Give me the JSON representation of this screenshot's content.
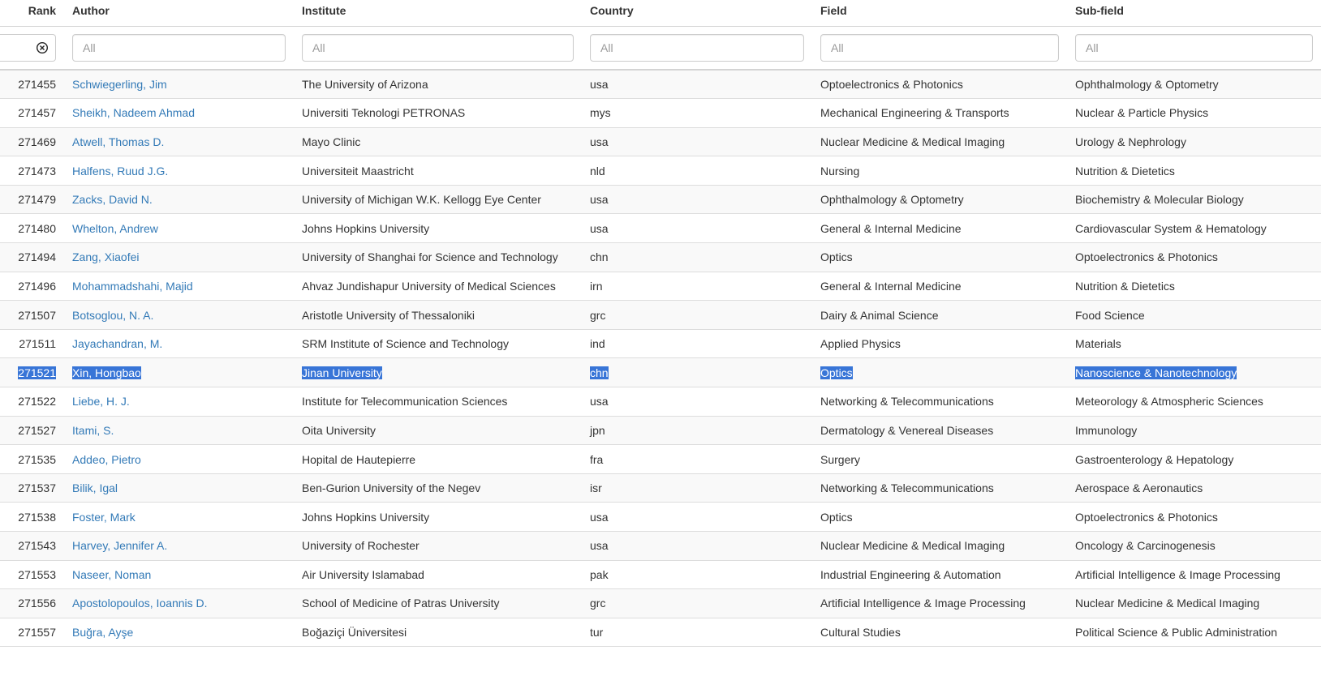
{
  "columns": {
    "rank": "Rank",
    "author": "Author",
    "institute": "Institute",
    "country": "Country",
    "field": "Field",
    "subfield": "Sub-field"
  },
  "filters": {
    "placeholder": "All"
  },
  "rows": [
    {
      "rank": "271455",
      "author": "Schwiegerling, Jim",
      "institute": "The University of Arizona",
      "country": "usa",
      "field": "Optoelectronics & Photonics",
      "subfield": "Ophthalmology & Optometry"
    },
    {
      "rank": "271457",
      "author": "Sheikh, Nadeem Ahmad",
      "institute": "Universiti Teknologi PETRONAS",
      "country": "mys",
      "field": "Mechanical Engineering & Transports",
      "subfield": "Nuclear & Particle Physics"
    },
    {
      "rank": "271469",
      "author": "Atwell, Thomas D.",
      "institute": "Mayo Clinic",
      "country": "usa",
      "field": "Nuclear Medicine & Medical Imaging",
      "subfield": "Urology & Nephrology"
    },
    {
      "rank": "271473",
      "author": "Halfens, Ruud J.G.",
      "institute": "Universiteit Maastricht",
      "country": "nld",
      "field": "Nursing",
      "subfield": "Nutrition & Dietetics"
    },
    {
      "rank": "271479",
      "author": "Zacks, David N.",
      "institute": "University of Michigan W.K. Kellogg Eye Center",
      "country": "usa",
      "field": "Ophthalmology & Optometry",
      "subfield": "Biochemistry & Molecular Biology"
    },
    {
      "rank": "271480",
      "author": "Whelton, Andrew",
      "institute": "Johns Hopkins University",
      "country": "usa",
      "field": "General & Internal Medicine",
      "subfield": "Cardiovascular System & Hematology"
    },
    {
      "rank": "271494",
      "author": "Zang, Xiaofei",
      "institute": "University of Shanghai for Science and Technology",
      "country": "chn",
      "field": "Optics",
      "subfield": "Optoelectronics & Photonics"
    },
    {
      "rank": "271496",
      "author": "Mohammadshahi, Majid",
      "institute": "Ahvaz Jundishapur University of Medical Sciences",
      "country": "irn",
      "field": "General & Internal Medicine",
      "subfield": "Nutrition & Dietetics"
    },
    {
      "rank": "271507",
      "author": "Botsoglou, N. A.",
      "institute": "Aristotle University of Thessaloniki",
      "country": "grc",
      "field": "Dairy & Animal Science",
      "subfield": "Food Science"
    },
    {
      "rank": "271511",
      "author": "Jayachandran, M.",
      "institute": "SRM Institute of Science and Technology",
      "country": "ind",
      "field": "Applied Physics",
      "subfield": "Materials"
    },
    {
      "rank": "271521",
      "author": "Xin, Hongbao",
      "institute": "Jinan University",
      "country": "chn",
      "field": "Optics",
      "subfield": "Nanoscience & Nanotechnology"
    },
    {
      "rank": "271522",
      "author": "Liebe, H. J.",
      "institute": "Institute for Telecommunication Sciences",
      "country": "usa",
      "field": "Networking & Telecommunications",
      "subfield": "Meteorology & Atmospheric Sciences"
    },
    {
      "rank": "271527",
      "author": "Itami, S.",
      "institute": "Oita University",
      "country": "jpn",
      "field": "Dermatology & Venereal Diseases",
      "subfield": "Immunology"
    },
    {
      "rank": "271535",
      "author": "Addeo, Pietro",
      "institute": "Hopital de Hautepierre",
      "country": "fra",
      "field": "Surgery",
      "subfield": "Gastroenterology & Hepatology"
    },
    {
      "rank": "271537",
      "author": "Bilik, Igal",
      "institute": "Ben-Gurion University of the Negev",
      "country": "isr",
      "field": "Networking & Telecommunications",
      "subfield": "Aerospace & Aeronautics"
    },
    {
      "rank": "271538",
      "author": "Foster, Mark",
      "institute": "Johns Hopkins University",
      "country": "usa",
      "field": "Optics",
      "subfield": "Optoelectronics & Photonics"
    },
    {
      "rank": "271543",
      "author": "Harvey, Jennifer A.",
      "institute": "University of Rochester",
      "country": "usa",
      "field": "Nuclear Medicine & Medical Imaging",
      "subfield": "Oncology & Carcinogenesis"
    },
    {
      "rank": "271553",
      "author": "Naseer, Noman",
      "institute": "Air University Islamabad",
      "country": "pak",
      "field": "Industrial Engineering & Automation",
      "subfield": "Artificial Intelligence & Image Processing"
    },
    {
      "rank": "271556",
      "author": "Apostolopoulos, Ioannis D.",
      "institute": "School of Medicine of Patras University",
      "country": "grc",
      "field": "Artificial Intelligence & Image Processing",
      "subfield": "Nuclear Medicine & Medical Imaging"
    },
    {
      "rank": "271557",
      "author": "Buğra, Ayşe",
      "institute": "Boğaziçi Üniversitesi",
      "country": "tur",
      "field": "Cultural Studies",
      "subfield": "Political Science & Public Administration"
    }
  ],
  "selected_row_index": 10,
  "colors": {
    "link": "#337ab7",
    "selection": "#3875d7",
    "stripe": "#f9f9f9",
    "border": "#dddddd"
  }
}
